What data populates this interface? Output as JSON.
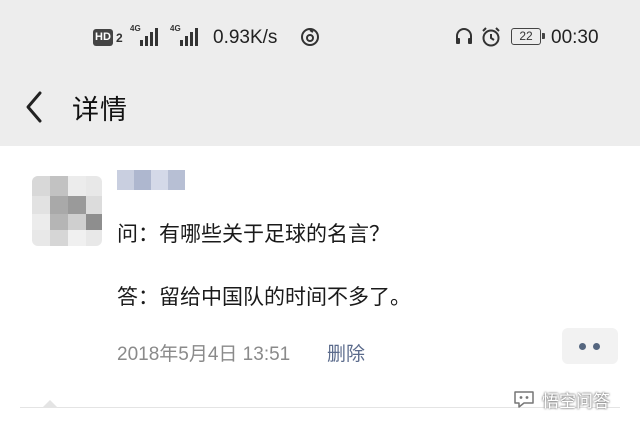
{
  "status_bar": {
    "hd_label": "HD",
    "hd_num": "2",
    "network_1": "4G",
    "network_2": "4G",
    "speed": "0.93K/s",
    "battery": "22",
    "time": "00:30"
  },
  "navbar": {
    "back_icon": "chevron-left-icon",
    "title": "详情"
  },
  "post": {
    "question": "问：有哪些关于足球的名言？",
    "answer": "答：留给中国队的时间不多了。",
    "date": "2018年5月4日 13:51",
    "delete_label": "删除",
    "more_icon": "more-dots-icon"
  },
  "watermark": {
    "text": "悟空问答"
  },
  "colors": {
    "header_bg": "#ededed",
    "link_blue": "#5b6b8c",
    "meta_gray": "#8a8a8a"
  }
}
